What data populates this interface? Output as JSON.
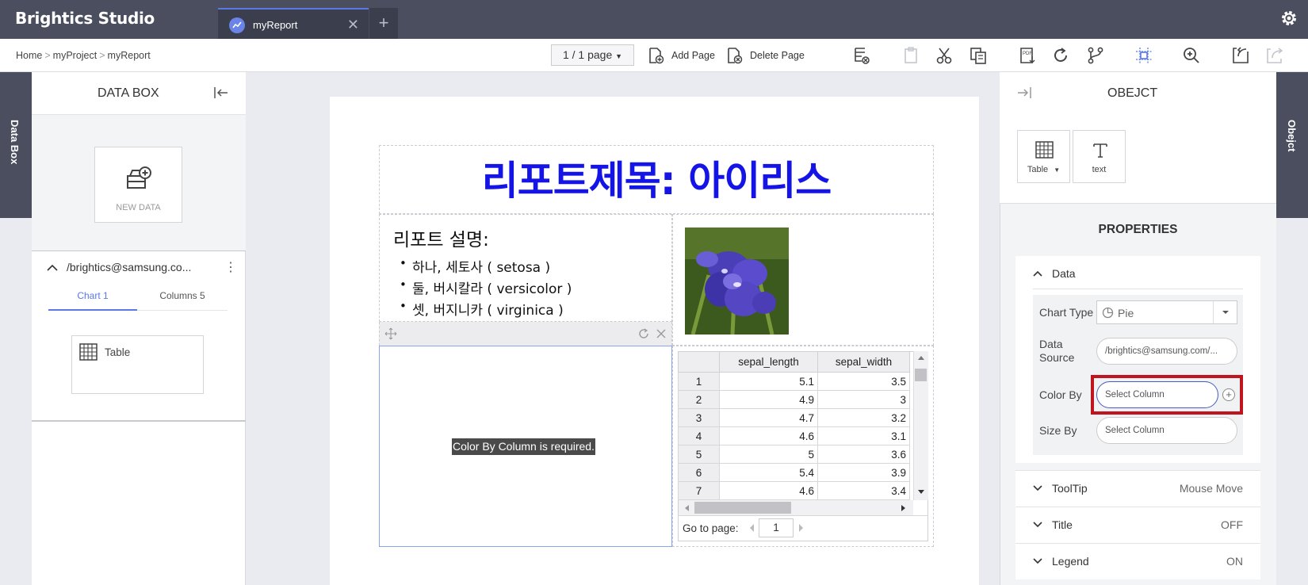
{
  "app": {
    "brand": "Brightics Studio",
    "tab_label": "myReport",
    "new_tab": "+",
    "close": "✕"
  },
  "breadcrumb": {
    "home": "Home",
    "project": "myProject",
    "report": "myReport",
    "sep": ">"
  },
  "toolbar": {
    "page_select": "1 / 1 page",
    "add_page": "Add Page",
    "delete_page": "Delete Page"
  },
  "data_box": {
    "side_tab": "Data Box",
    "title": "DATA BOX",
    "new_data": "NEW DATA",
    "datasource_path": "/brightics@samsung.co...",
    "more": "⋮",
    "tabs": [
      "Chart 1",
      "Columns 5"
    ],
    "active_tab": 0,
    "item_label": "Table"
  },
  "report": {
    "title": "리포트제목: 아이리스",
    "desc_title": "리포트 설명:",
    "desc_items": [
      "하나, 세토사 ( setosa )",
      "둘, 버시칼라 ( versicolor )",
      "셋, 버지니카 ( virginica )"
    ],
    "chart_message": "Color By Column is required."
  },
  "grid": {
    "columns": [
      "",
      "sepal_length",
      "sepal_width"
    ],
    "rows": [
      [
        "1",
        "5.1",
        "3.5"
      ],
      [
        "2",
        "4.9",
        "3"
      ],
      [
        "3",
        "4.7",
        "3.2"
      ],
      [
        "4",
        "4.6",
        "3.1"
      ],
      [
        "5",
        "5",
        "3.6"
      ],
      [
        "6",
        "5.4",
        "3.9"
      ],
      [
        "7",
        "4.6",
        "3.4"
      ]
    ],
    "goto_label": "Go to page:",
    "goto_value": "1"
  },
  "object_panel": {
    "side_tab": "Obejct",
    "title": "OBEJCT",
    "items": [
      {
        "label": "Table",
        "icon": "table-icon"
      },
      {
        "label": "text",
        "icon": "text-icon"
      }
    ]
  },
  "properties": {
    "title": "PROPERTIES",
    "data_section": "Data",
    "chart_type_label": "Chart Type",
    "chart_type_value": "Pie",
    "data_source_label": "Data Source",
    "data_source_value": "/brightics@samsung.com/...",
    "color_by_label": "Color By",
    "color_by_placeholder": "Select Column",
    "size_by_label": "Size By",
    "size_by_placeholder": "Select Column",
    "sections": [
      {
        "label": "ToolTip",
        "value": "Mouse Move"
      },
      {
        "label": "Title",
        "value": "OFF"
      },
      {
        "label": "Legend",
        "value": "ON"
      }
    ]
  },
  "colors": {
    "accent": "#5a78e8",
    "title_blue": "#1414e6",
    "highlight_red": "#c0151e",
    "header_dark": "#4a4e5e"
  }
}
